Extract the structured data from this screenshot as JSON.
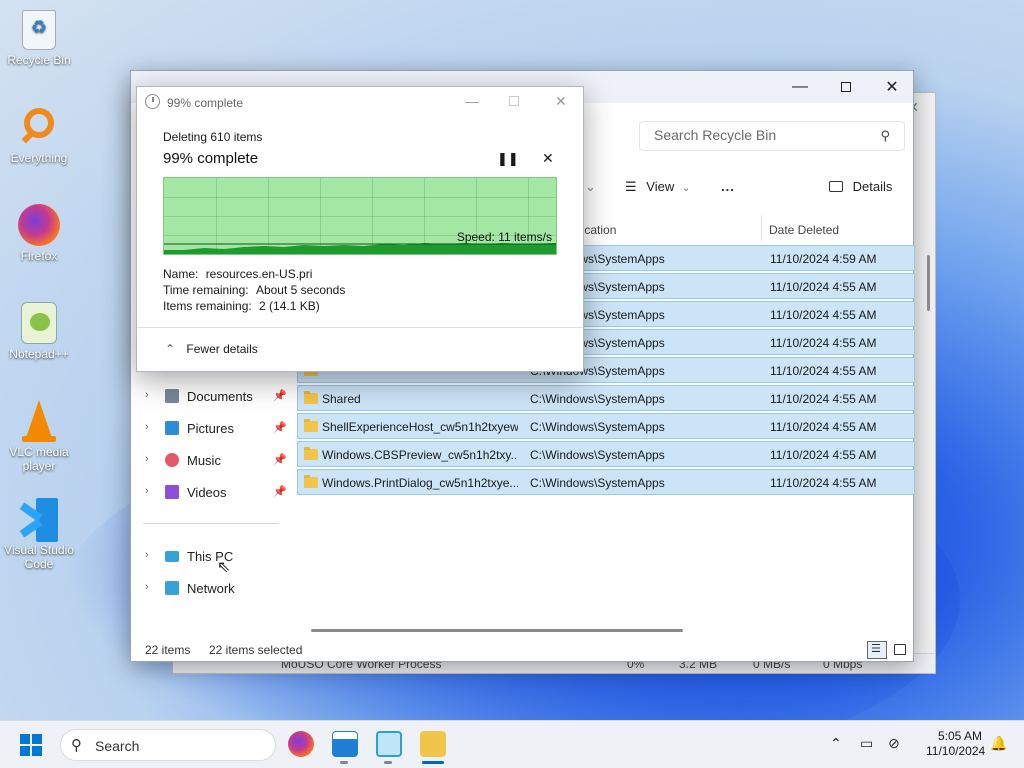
{
  "desktop": {
    "icons": [
      {
        "label": "Recycle Bin"
      },
      {
        "label": "Everything"
      },
      {
        "label": "Firefox"
      },
      {
        "label": "Notepad++"
      },
      {
        "label": "VLC media player"
      },
      {
        "label": "Visual Studio Code"
      }
    ]
  },
  "behind_window": {
    "process": "MoUSO Core Worker Process",
    "cpu": "0%",
    "memory": "3.2 MB",
    "disk": "0 MB/s",
    "network": "0 Mbps"
  },
  "explorer": {
    "search_placeholder": "Search Recycle Bin",
    "toolbar": {
      "view": "View",
      "more": "...",
      "details": "Details"
    },
    "columns": {
      "location": "Location",
      "date_deleted": "Date Deleted"
    },
    "rows": [
      {
        "name": "",
        "location": "C:\\Windows\\SystemApps",
        "date": "11/10/2024 4:59 AM"
      },
      {
        "name": "",
        "location": "C:\\Windows\\SystemApps",
        "date": "11/10/2024 4:55 AM"
      },
      {
        "name": "",
        "location": "C:\\Windows\\SystemApps",
        "date": "11/10/2024 4:55 AM"
      },
      {
        "name": "",
        "location": "C:\\Windows\\SystemApps",
        "date": "11/10/2024 4:55 AM"
      },
      {
        "name": "",
        "location": "C:\\Windows\\SystemApps",
        "date": "11/10/2024 4:55 AM"
      },
      {
        "name": "Shared",
        "location": "C:\\Windows\\SystemApps",
        "date": "11/10/2024 4:55 AM"
      },
      {
        "name": "ShellExperienceHost_cw5n1h2txyewy",
        "location": "C:\\Windows\\SystemApps",
        "date": "11/10/2024 4:55 AM"
      },
      {
        "name": "Windows.CBSPreview_cw5n1h2txy...",
        "location": "C:\\Windows\\SystemApps",
        "date": "11/10/2024 4:55 AM"
      },
      {
        "name": "Windows.PrintDialog_cw5n1h2txye...",
        "location": "C:\\Windows\\SystemApps",
        "date": "11/10/2024 4:55 AM"
      }
    ],
    "nav": [
      {
        "label": "Documents",
        "pinned": true
      },
      {
        "label": "Pictures",
        "pinned": true
      },
      {
        "label": "Music",
        "pinned": true
      },
      {
        "label": "Videos",
        "pinned": true
      },
      {
        "label": "This PC",
        "pinned": false
      },
      {
        "label": "Network",
        "pinned": false
      }
    ],
    "status": {
      "items": "22 items",
      "selected": "22 items selected"
    }
  },
  "dialog": {
    "title": "99% complete",
    "deleting": "Deleting 610 items",
    "heading": "99% complete",
    "speed": "Speed: 11 items/s",
    "name_label": "Name:",
    "name_value": "resources.en-US.pri",
    "time_label": "Time remaining:",
    "time_value": "About 5 seconds",
    "items_label": "Items remaining:",
    "items_value": "2 (14.1 KB)",
    "fewer_details": "Fewer details",
    "progress": 0.99
  },
  "taskbar": {
    "search": "Search",
    "time": "5:05 AM",
    "date": "11/10/2024"
  },
  "colors": {
    "accent": "#0067c0",
    "selection": "#cce4f7",
    "progress_green": "#a4e6a4"
  }
}
